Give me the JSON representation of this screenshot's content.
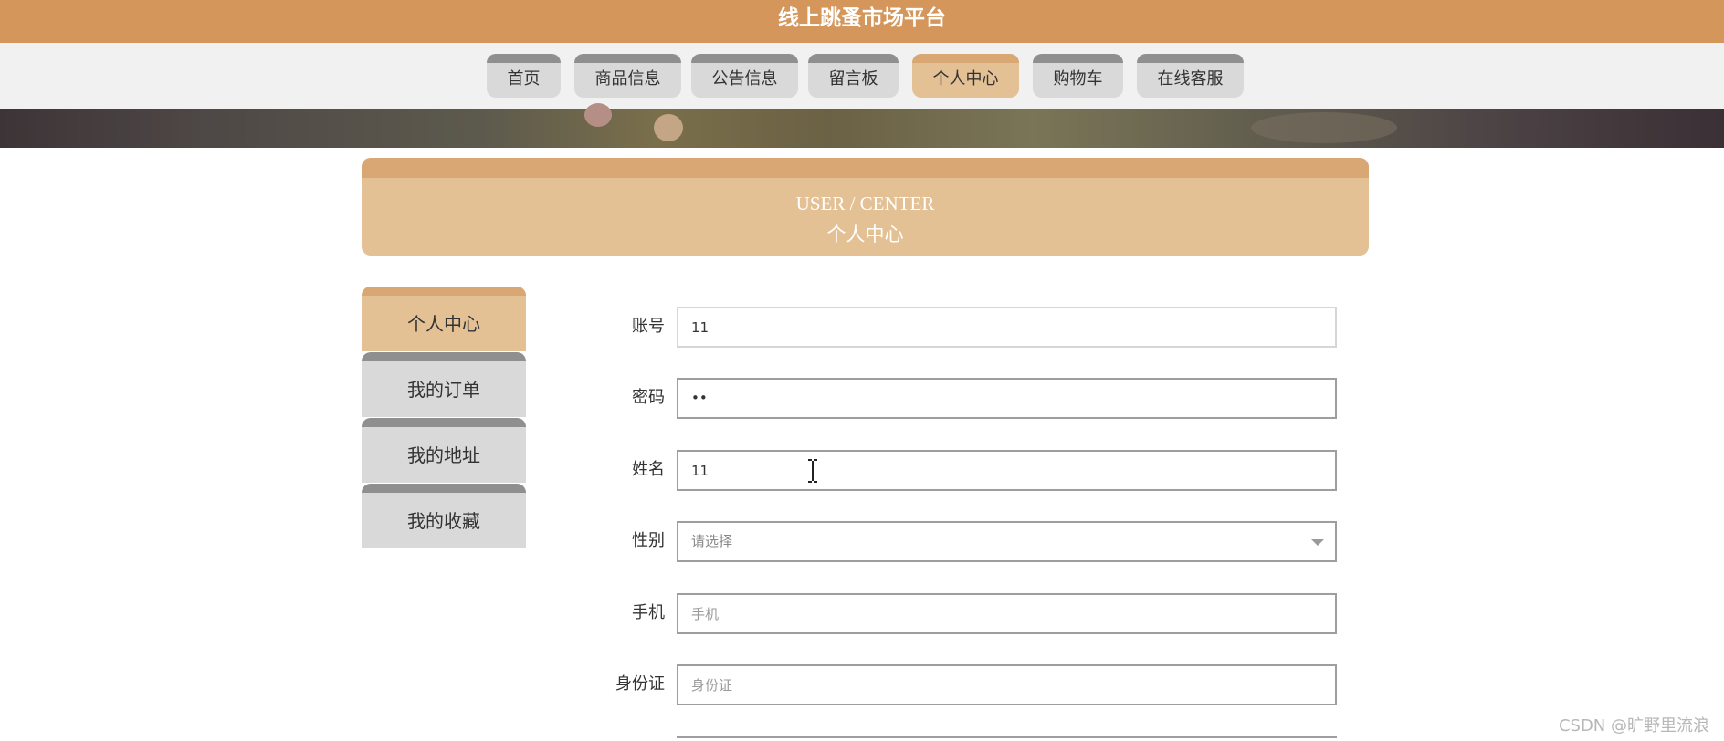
{
  "header": {
    "title": "线上跳蚤市场平台"
  },
  "nav": {
    "items": [
      {
        "label": "首页",
        "active": false
      },
      {
        "label": "商品信息",
        "active": false
      },
      {
        "label": "公告信息",
        "active": false
      },
      {
        "label": "留言板",
        "active": false
      },
      {
        "label": "个人中心",
        "active": true
      },
      {
        "label": "购物车",
        "active": false
      },
      {
        "label": "在线客服",
        "active": false
      }
    ]
  },
  "user_center": {
    "title_en": "USER / CENTER",
    "title_cn": "个人中心"
  },
  "sidebar": {
    "items": [
      {
        "label": "个人中心",
        "active": true
      },
      {
        "label": "我的订单",
        "active": false
      },
      {
        "label": "我的地址",
        "active": false
      },
      {
        "label": "我的收藏",
        "active": false
      }
    ]
  },
  "form": {
    "account": {
      "label": "账号",
      "value": "11"
    },
    "password": {
      "label": "密码",
      "value": "••"
    },
    "name": {
      "label": "姓名",
      "value": "11"
    },
    "gender": {
      "label": "性别",
      "placeholder": "请选择"
    },
    "phone": {
      "label": "手机",
      "placeholder": "手机"
    },
    "id_card": {
      "label": "身份证",
      "placeholder": "身份证"
    }
  },
  "watermark": "CSDN @旷野里流浪",
  "colors": {
    "brand": "#d4965a",
    "accent_light": "#e3c195",
    "tab_gray": "#d9d9d9"
  }
}
